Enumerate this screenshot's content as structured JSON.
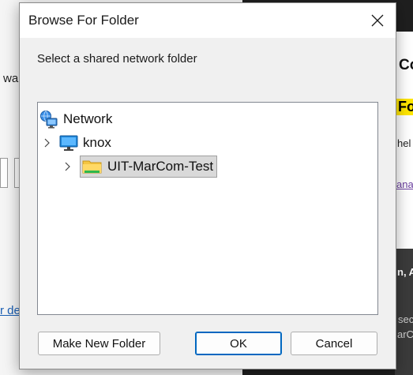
{
  "background": {
    "left_fragment_1": "wa",
    "left_link_fragment": "r de",
    "right_heading_fragment": "Co",
    "right_highlight_fragment": "Fo",
    "right_text_fragment": "hel",
    "right_link_fragment": "ana",
    "right_bold_fragment": "n, A",
    "right_grey_fragment_1": "sec",
    "right_grey_fragment_2": "arC"
  },
  "dialog": {
    "title": "Browse For Folder",
    "instruction": "Select a shared network folder",
    "tree": [
      {
        "label": "Network",
        "icon": "network-icon",
        "level": 0,
        "expandable": false,
        "selected": false
      },
      {
        "label": "knox",
        "icon": "computer-icon",
        "level": 1,
        "expandable": true,
        "selected": false
      },
      {
        "label": "UIT-MarCom-Test",
        "icon": "folder-icon",
        "level": 2,
        "expandable": true,
        "selected": true
      }
    ],
    "buttons": {
      "make_new_folder": "Make New Folder",
      "ok": "OK",
      "cancel": "Cancel"
    }
  }
}
